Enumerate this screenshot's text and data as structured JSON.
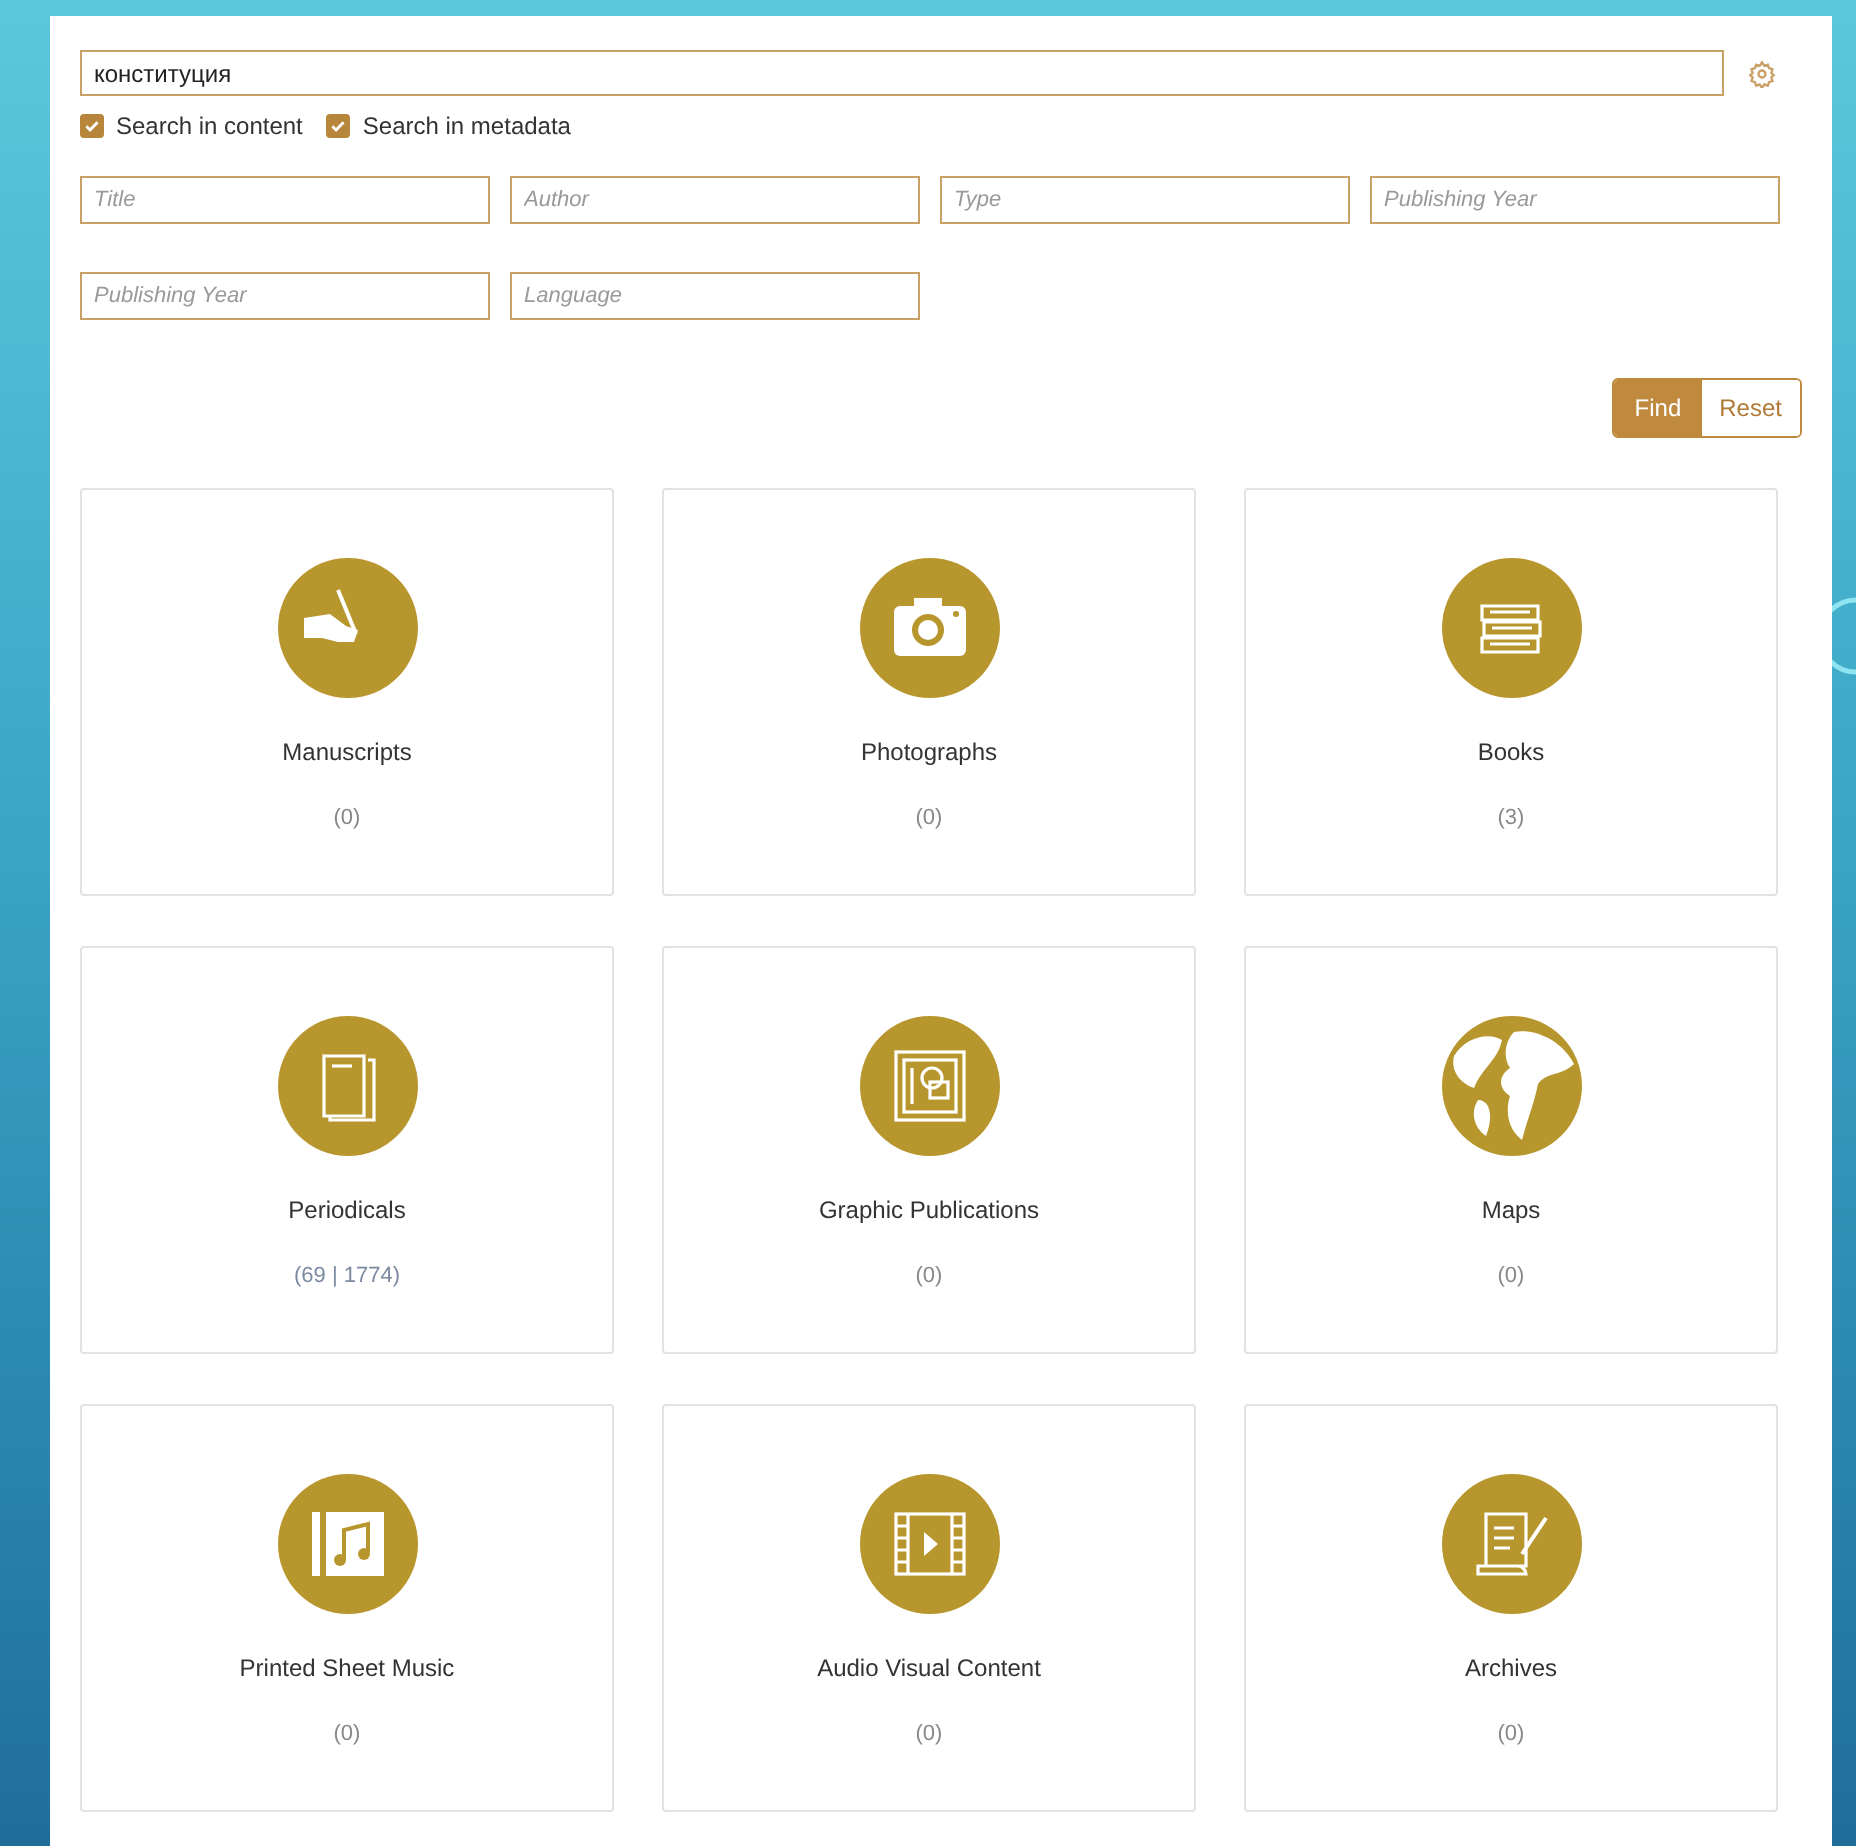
{
  "search": {
    "value": "конституция"
  },
  "options": [
    {
      "label": "Search in content",
      "checked": true
    },
    {
      "label": "Search in metadata",
      "checked": true
    }
  ],
  "filters": [
    {
      "placeholder": "Title"
    },
    {
      "placeholder": "Author"
    },
    {
      "placeholder": "Type"
    },
    {
      "placeholder": "Publishing Year"
    },
    {
      "placeholder": "Publishing Year"
    },
    {
      "placeholder": "Language"
    }
  ],
  "buttons": [
    {
      "label": "Find",
      "selected": true
    },
    {
      "label": "Reset",
      "selected": false
    }
  ],
  "categories": [
    {
      "name": "Manuscripts",
      "count": "(0)",
      "linked": false
    },
    {
      "name": "Photographs",
      "count": "(0)",
      "linked": false
    },
    {
      "name": "Books",
      "count": "(3)",
      "linked": false
    },
    {
      "name": "Periodicals",
      "count": "(69 | 1774)",
      "linked": true
    },
    {
      "name": "Graphic Publications",
      "count": "(0)",
      "linked": false
    },
    {
      "name": "Maps",
      "count": "(0)",
      "linked": false
    },
    {
      "name": "Printed Sheet Music",
      "count": "(0)",
      "linked": false
    },
    {
      "name": "Audio Visual Content",
      "count": "(0)",
      "linked": false
    },
    {
      "name": "Archives",
      "count": "(0)",
      "linked": false
    }
  ]
}
